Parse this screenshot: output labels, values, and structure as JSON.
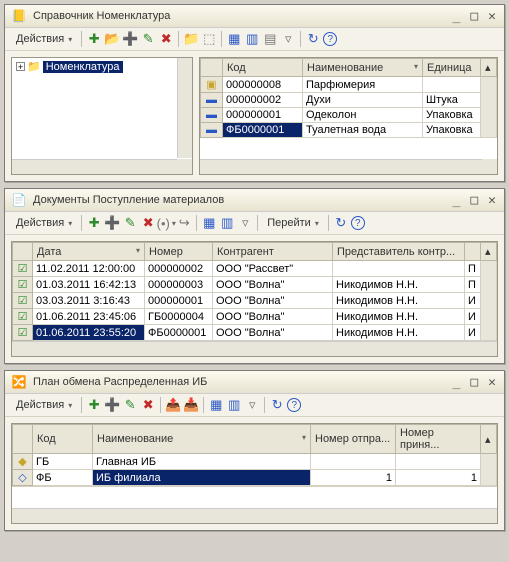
{
  "w1": {
    "title": "Справочник Номенклатура",
    "actions_label": "Действия",
    "tree_root": "Номенклатура",
    "cols": {
      "code": "Код",
      "name": "Наименование",
      "unit": "Единица"
    },
    "rows": [
      {
        "code": "000000008",
        "name": "Парфюмерия",
        "unit": "",
        "kind": "folder"
      },
      {
        "code": "000000002",
        "name": "Духи",
        "unit": "Штука",
        "kind": "item"
      },
      {
        "code": "000000001",
        "name": "Одеколон",
        "unit": "Упаковка",
        "kind": "item"
      },
      {
        "code": "ФБ0000001",
        "name": "Туалетная вода",
        "unit": "Упаковка",
        "kind": "item",
        "selected": true
      }
    ]
  },
  "w2": {
    "title": "Документы Поступление материалов",
    "actions_label": "Действия",
    "goto_label": "Перейти",
    "cols": {
      "date": "Дата",
      "num": "Номер",
      "contr": "Контрагент",
      "rep": "Представитель контр..."
    },
    "rows": [
      {
        "date": "11.02.2011 12:00:00",
        "num": "000000002",
        "contr": "ООО \"Рассвет\"",
        "rep": "",
        "p": "П"
      },
      {
        "date": "01.03.2011 16:42:13",
        "num": "000000003",
        "contr": "ООО \"Волна\"",
        "rep": "Никодимов Н.Н.",
        "p": "П"
      },
      {
        "date": "03.03.2011 3:16:43",
        "num": "000000001",
        "contr": "ООО \"Волна\"",
        "rep": "Никодимов Н.Н.",
        "p": "И"
      },
      {
        "date": "01.06.2011 23:45:06",
        "num": "ГБ0000004",
        "contr": "ООО \"Волна\"",
        "rep": "Никодимов Н.Н.",
        "p": "И"
      },
      {
        "date": "01.06.2011 23:55:20",
        "num": "ФБ0000001",
        "contr": "ООО \"Волна\"",
        "rep": "Никодимов Н.Н.",
        "p": "И",
        "selected": true
      }
    ]
  },
  "w3": {
    "title": "План обмена Распределенная ИБ",
    "actions_label": "Действия",
    "cols": {
      "code": "Код",
      "name": "Наименование",
      "sent": "Номер отпра...",
      "recv": "Номер приня..."
    },
    "rows": [
      {
        "code": "ГБ",
        "name": "Главная ИБ",
        "sent": "",
        "recv": "",
        "icon": "main"
      },
      {
        "code": "ФБ",
        "name": "ИБ филиала",
        "sent": "1",
        "recv": "1",
        "icon": "branch",
        "selected": true
      }
    ]
  },
  "icons": {
    "actions": "Действия",
    "add": "➕",
    "add_folder": "📁",
    "copy": "📋",
    "edit": "✎",
    "delete": "✖",
    "mark": "⬚",
    "move": "➔",
    "filter": "▦",
    "find": "🔍",
    "refresh": "↻",
    "help": "?",
    "settings": "⚙"
  }
}
